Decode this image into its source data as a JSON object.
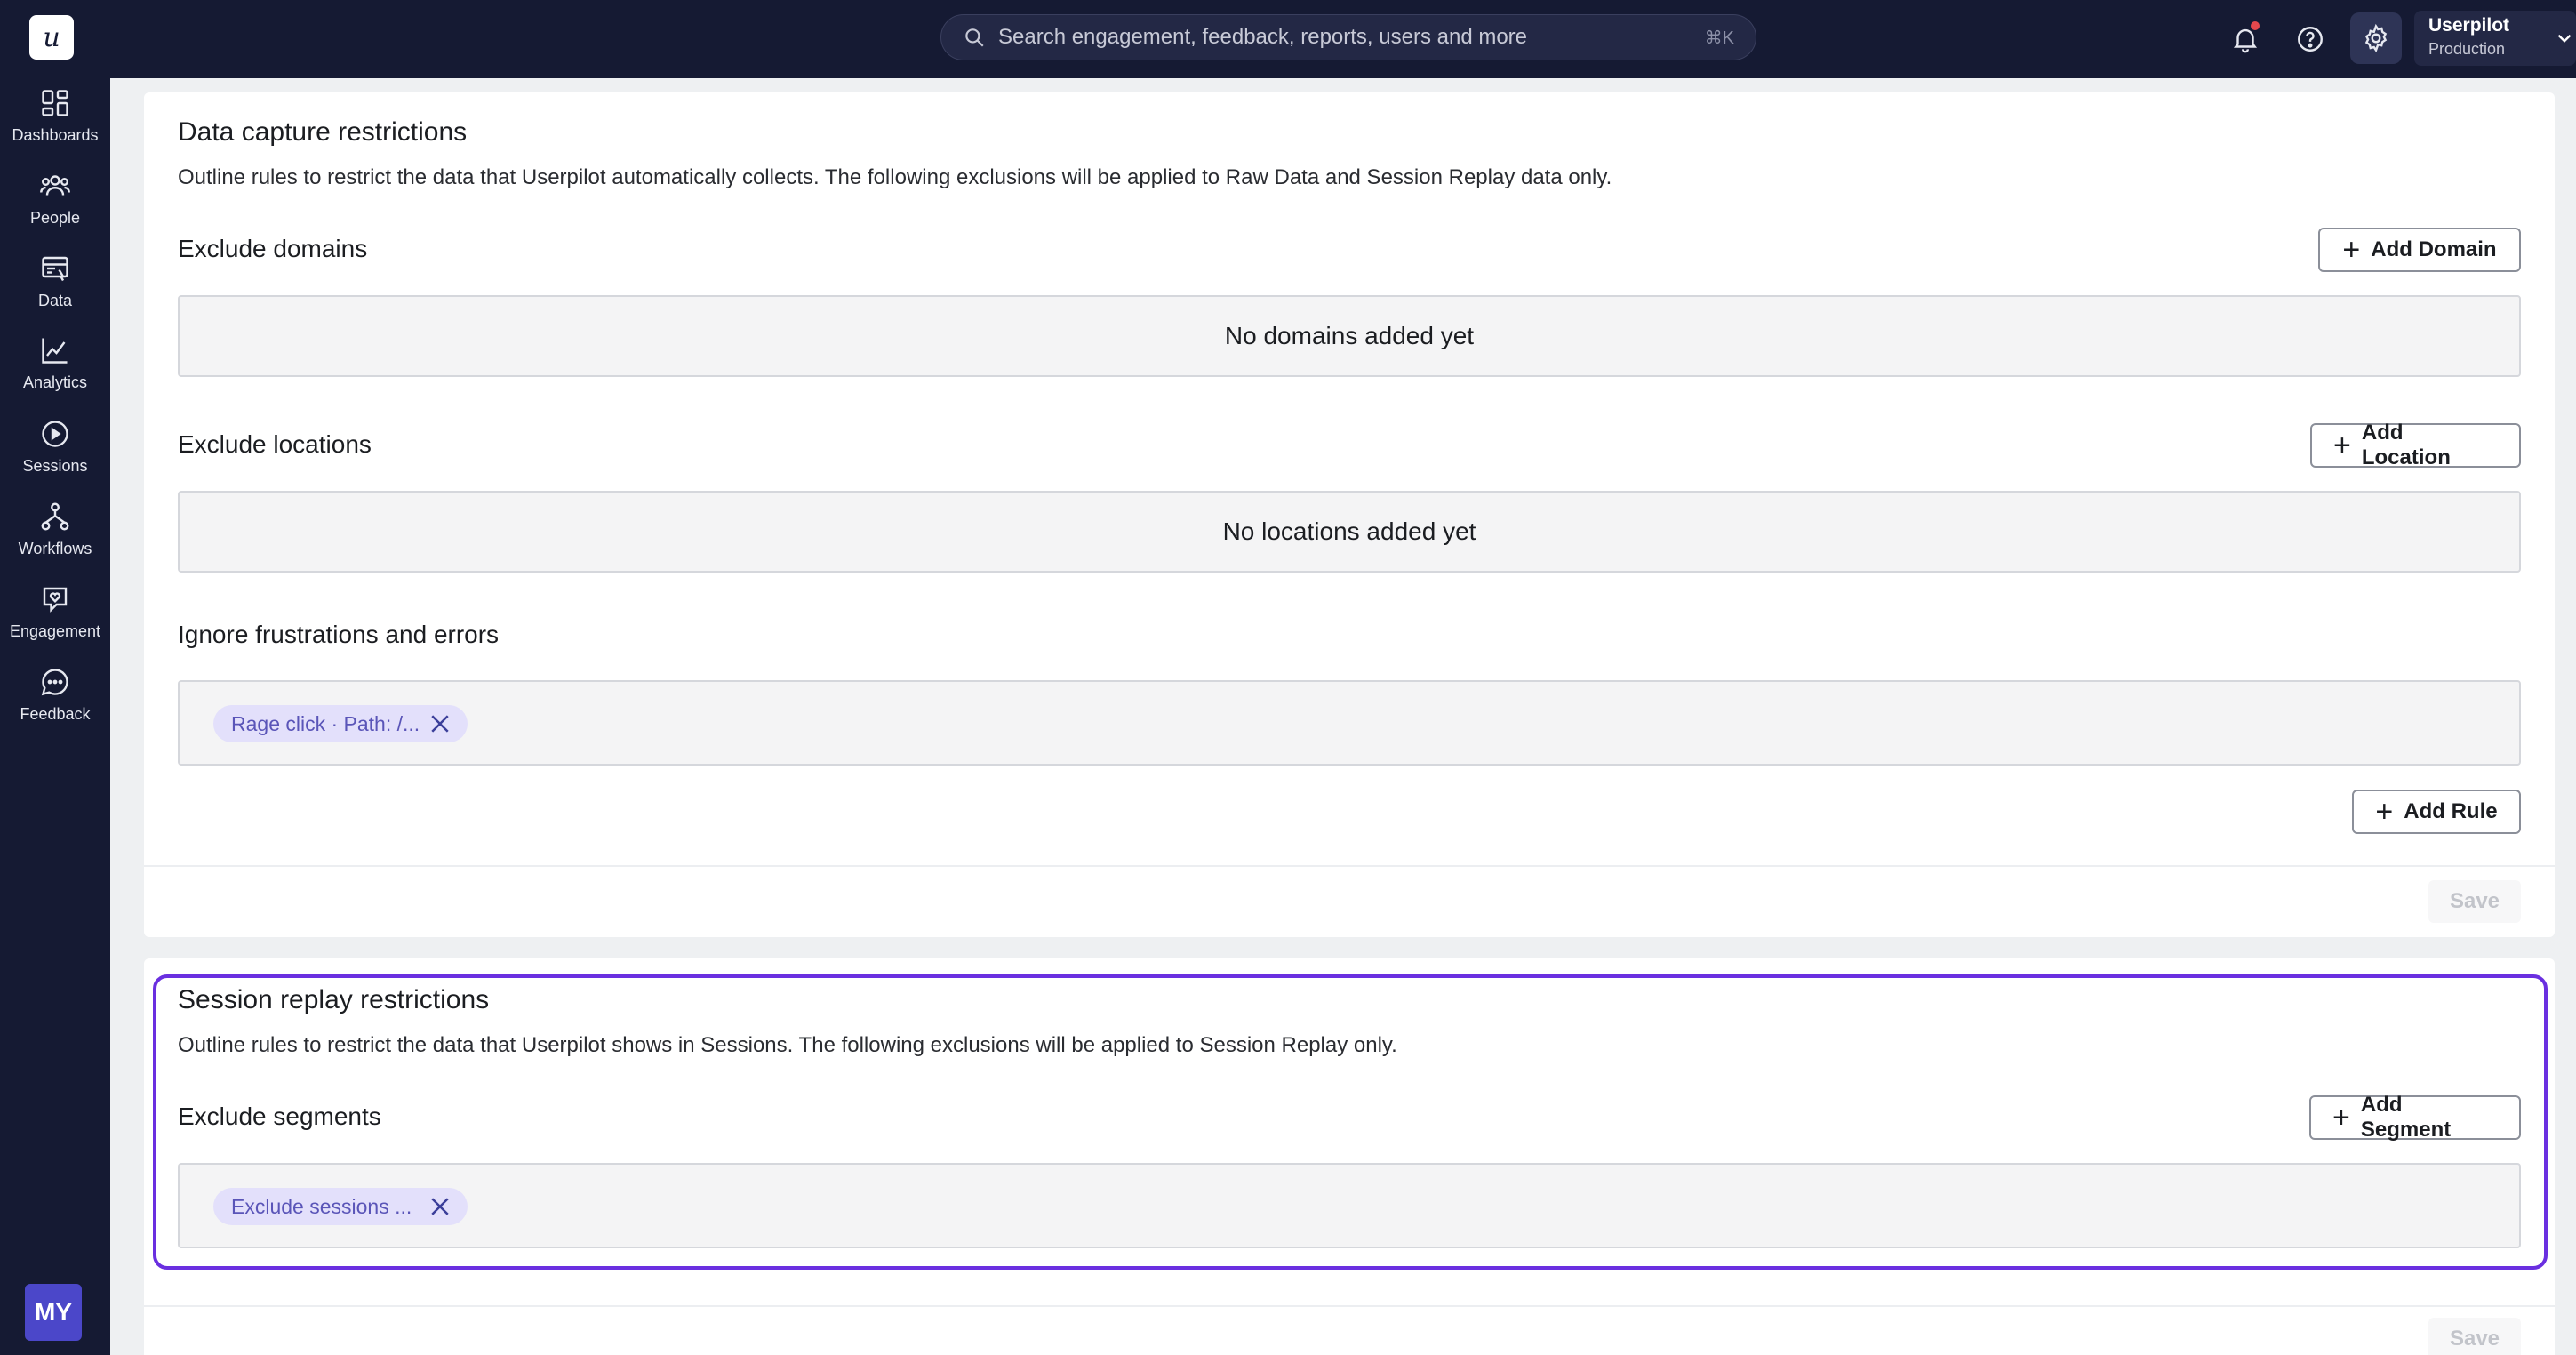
{
  "sidebar": {
    "logo": "u",
    "items": [
      {
        "label": "Dashboards",
        "icon": "dashboard-icon"
      },
      {
        "label": "People",
        "icon": "people-icon"
      },
      {
        "label": "Data",
        "icon": "data-icon"
      },
      {
        "label": "Analytics",
        "icon": "analytics-icon"
      },
      {
        "label": "Sessions",
        "icon": "play-circle-icon"
      },
      {
        "label": "Workflows",
        "icon": "workflow-icon"
      },
      {
        "label": "Engagement",
        "icon": "engagement-icon"
      },
      {
        "label": "Feedback",
        "icon": "chat-bubble-icon"
      }
    ],
    "avatar_initials": "MY"
  },
  "topbar": {
    "search_placeholder": "Search engagement, feedback, reports, users and more",
    "search_shortcut": "⌘K",
    "account_name": "Userpilot",
    "account_env": "Production"
  },
  "data_capture": {
    "title": "Data capture restrictions",
    "description": "Outline rules to restrict the data that Userpilot automatically collects. The following exclusions will be applied to Raw Data and Session Replay data only.",
    "exclude_domains": {
      "title": "Exclude domains",
      "button": "Add Domain",
      "empty": "No domains added yet"
    },
    "exclude_locations": {
      "title": "Exclude locations",
      "button": "Add Location",
      "empty": "No locations added yet"
    },
    "ignore_frustrations": {
      "title": "Ignore frustrations and errors",
      "chip": "Rage click · Path: /...",
      "button": "Add Rule"
    },
    "save": "Save"
  },
  "session_replay": {
    "title": "Session replay restrictions",
    "description": "Outline rules to restrict the data that Userpilot shows in Sessions. The following exclusions will be applied to Session Replay only.",
    "exclude_segments": {
      "title": "Exclude segments",
      "button": "Add Segment",
      "chip": "Exclude sessions ..."
    },
    "save": "Save"
  },
  "colors": {
    "sidebar_bg": "#151a33",
    "highlight": "#6a2fe0",
    "chip_bg": "#e3e0fb",
    "avatar_bg": "#4b47c9"
  }
}
